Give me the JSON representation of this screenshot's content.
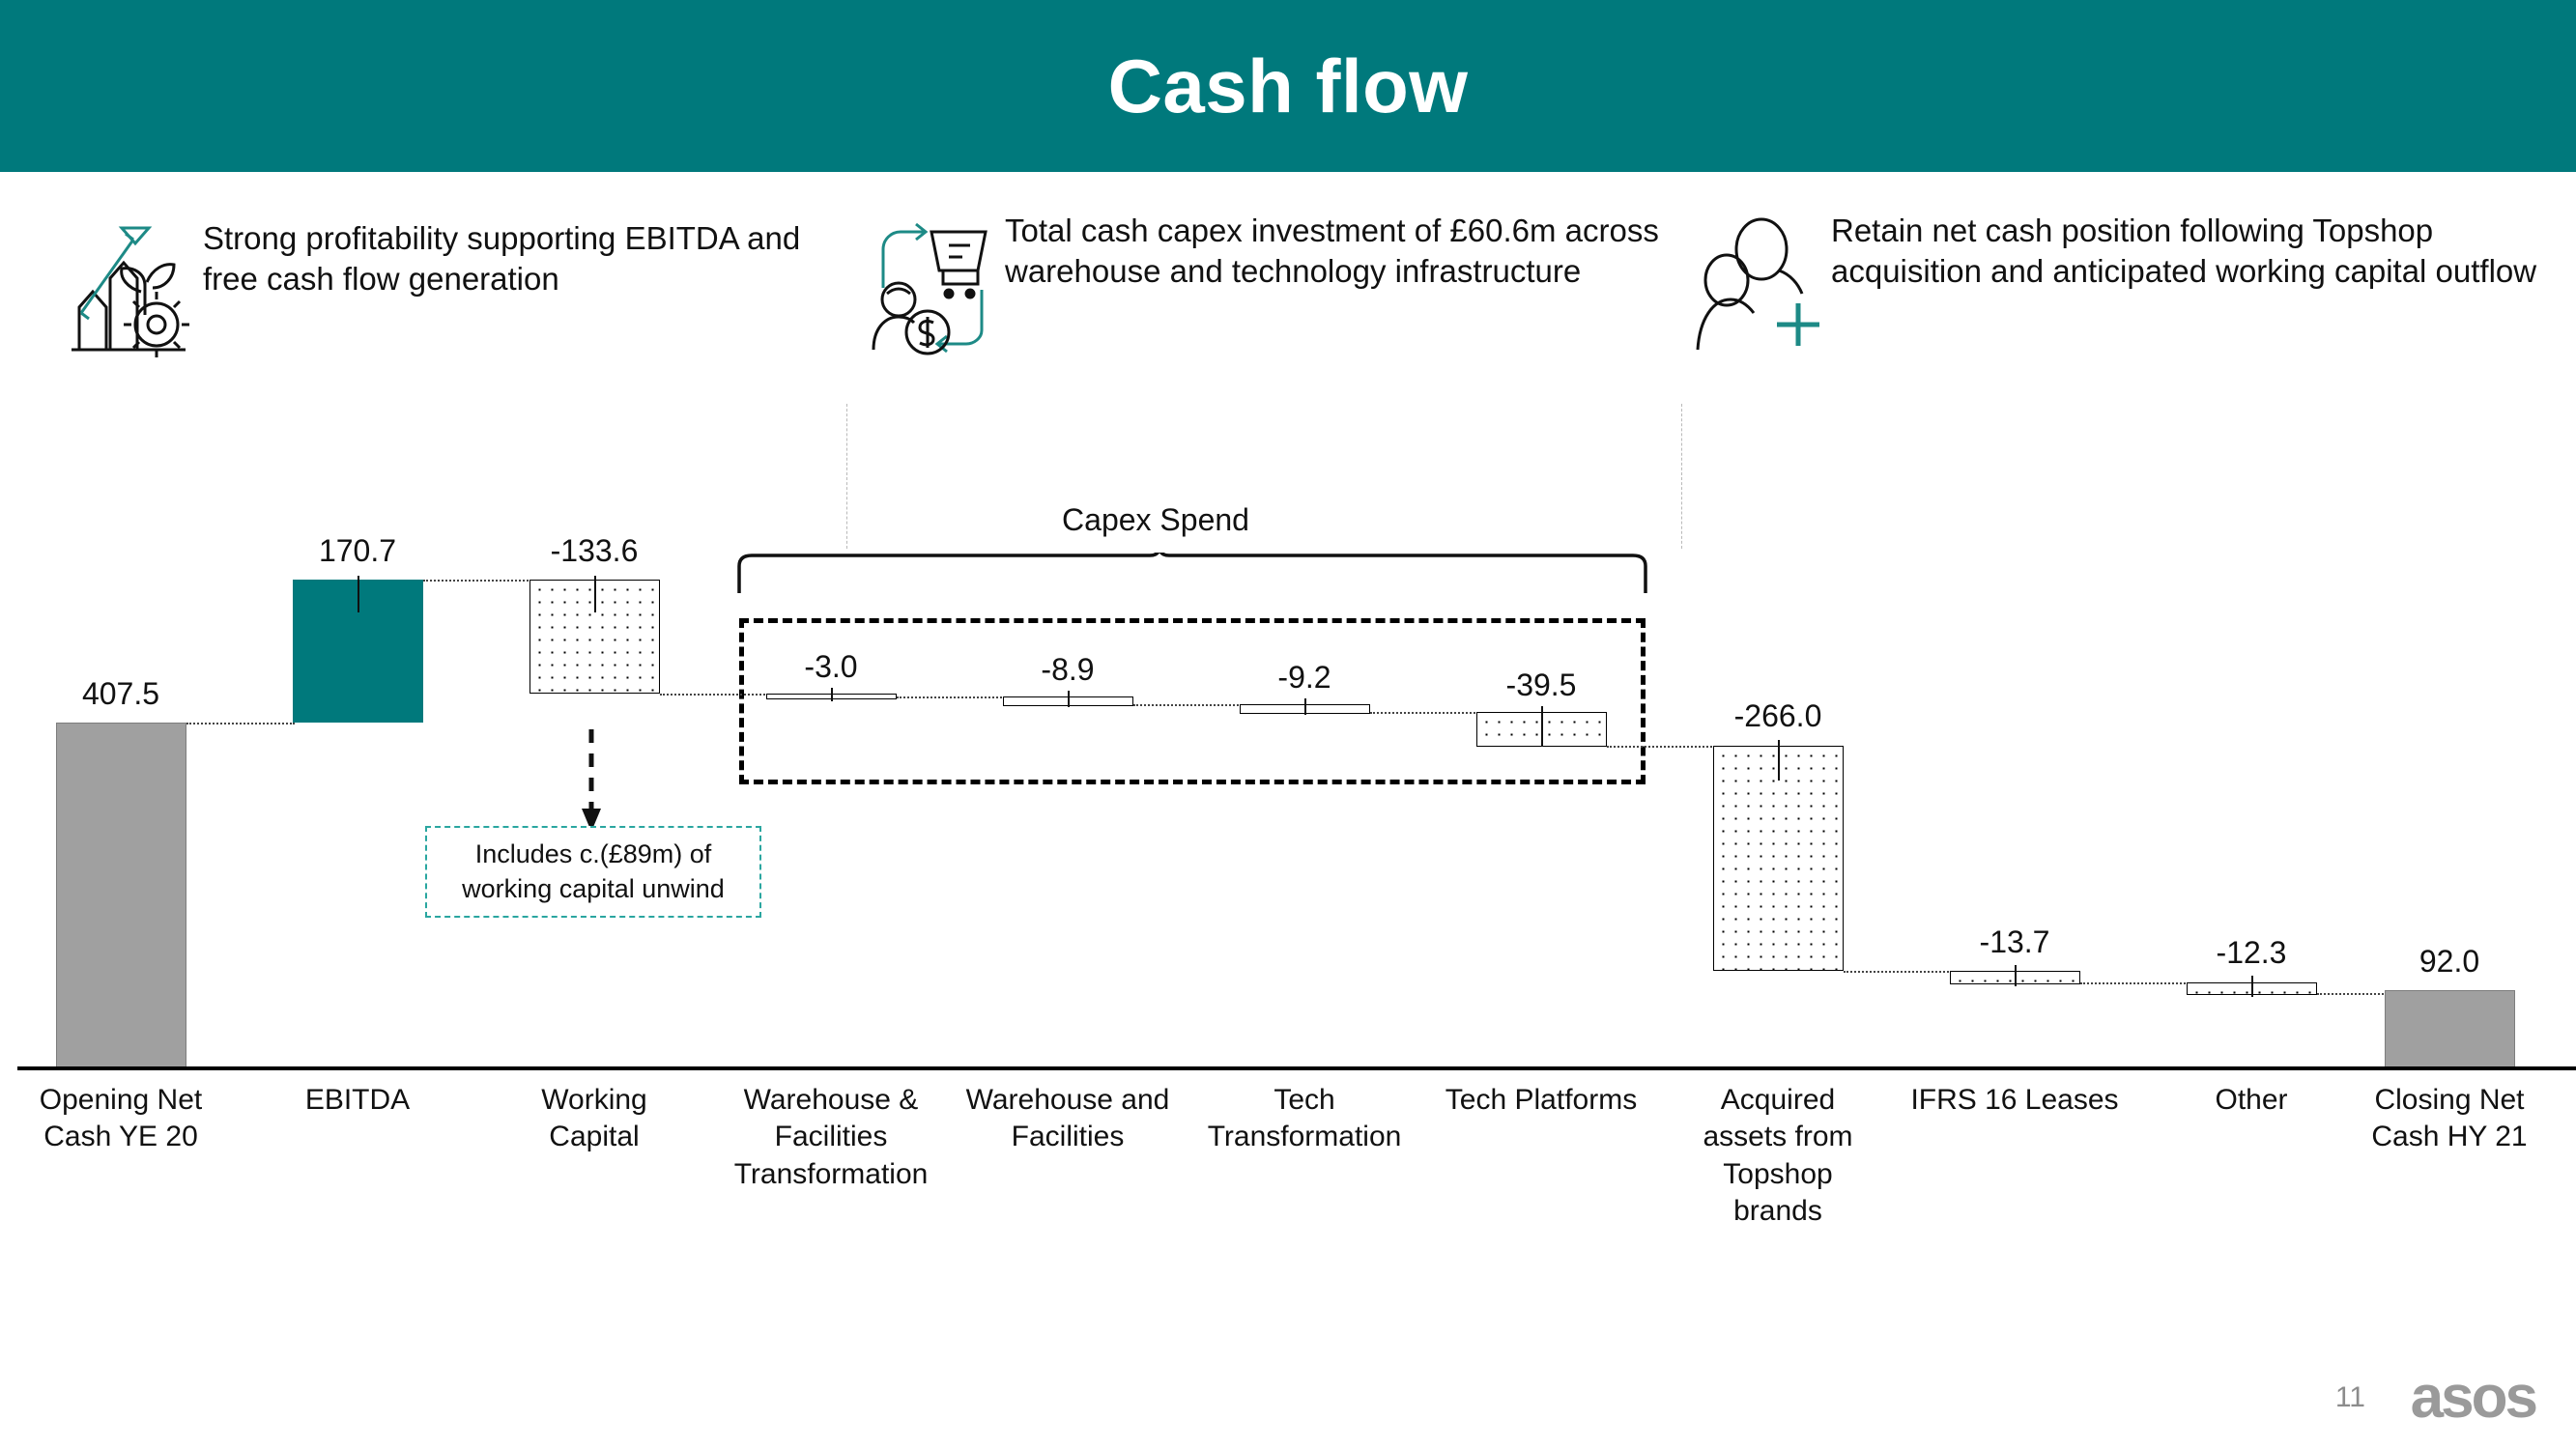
{
  "header": {
    "title": "Cash flow"
  },
  "highlights": [
    {
      "icon": "growth-chart-icon",
      "text": "Strong profitability supporting EBITDA and free cash flow generation"
    },
    {
      "icon": "cash-capex-cycle-icon",
      "text": "Total cash capex investment of £60.6m across warehouse and technology infrastructure"
    },
    {
      "icon": "people-plus-icon",
      "text": "Retain net cash position following Topshop acquisition and anticipated working capital outflow"
    }
  ],
  "capex": {
    "bracket_label": "Capex Spend"
  },
  "note": {
    "text": "Includes c.(£89m) of working capital unwind"
  },
  "footer": {
    "page_number": "11",
    "logo": "asos"
  },
  "colors": {
    "brand_teal": "#00797c",
    "bar_grey": "#a0a0a0",
    "note_border": "#2aa6a0",
    "footer_grey": "#9a9a9a"
  },
  "chart_data": {
    "type": "bar",
    "title": "Cash flow",
    "subtype": "waterfall",
    "xlabel": "",
    "ylabel": "",
    "grid": false,
    "legend": null,
    "ylim": [
      0,
      420
    ],
    "baseline_value": 0,
    "categories": [
      "Opening Net Cash YE 20",
      "EBITDA",
      "Working Capital",
      "Warehouse & Facilities Transformation",
      "Warehouse and Facilities",
      "Tech Transformation",
      "Tech Platforms",
      "Acquired assets from Topshop brands",
      "IFRS 16 Leases",
      "Other",
      "Closing Net Cash HY 21"
    ],
    "values": [
      407.5,
      170.7,
      -133.6,
      -3.0,
      -8.9,
      -9.2,
      -39.5,
      -266.0,
      -13.7,
      -12.3,
      92.0
    ],
    "value_labels": [
      "407.5",
      "170.7",
      "-133.6",
      "-3.0",
      "-8.9",
      "-9.2",
      "-39.5",
      "-266.0",
      "-13.7",
      "-12.3",
      "92.0"
    ],
    "bar_types": [
      "total",
      "increase",
      "decrease",
      "decrease",
      "decrease",
      "decrease",
      "decrease",
      "decrease",
      "decrease",
      "decrease",
      "total"
    ],
    "cumulative_tops": [
      407.5,
      578.2,
      578.2,
      444.6,
      441.6,
      432.7,
      423.5,
      384.0,
      118.0,
      104.3,
      92.0
    ],
    "annotations": [
      {
        "name": "capex-bracket",
        "label": "Capex Spend",
        "covers": [
          "Warehouse & Facilities Transformation",
          "Warehouse and Facilities",
          "Tech Transformation",
          "Tech Platforms"
        ]
      },
      {
        "name": "working-capital-note",
        "label": "Includes c.(£89m) of working capital unwind",
        "points_to": "Working Capital"
      }
    ]
  }
}
